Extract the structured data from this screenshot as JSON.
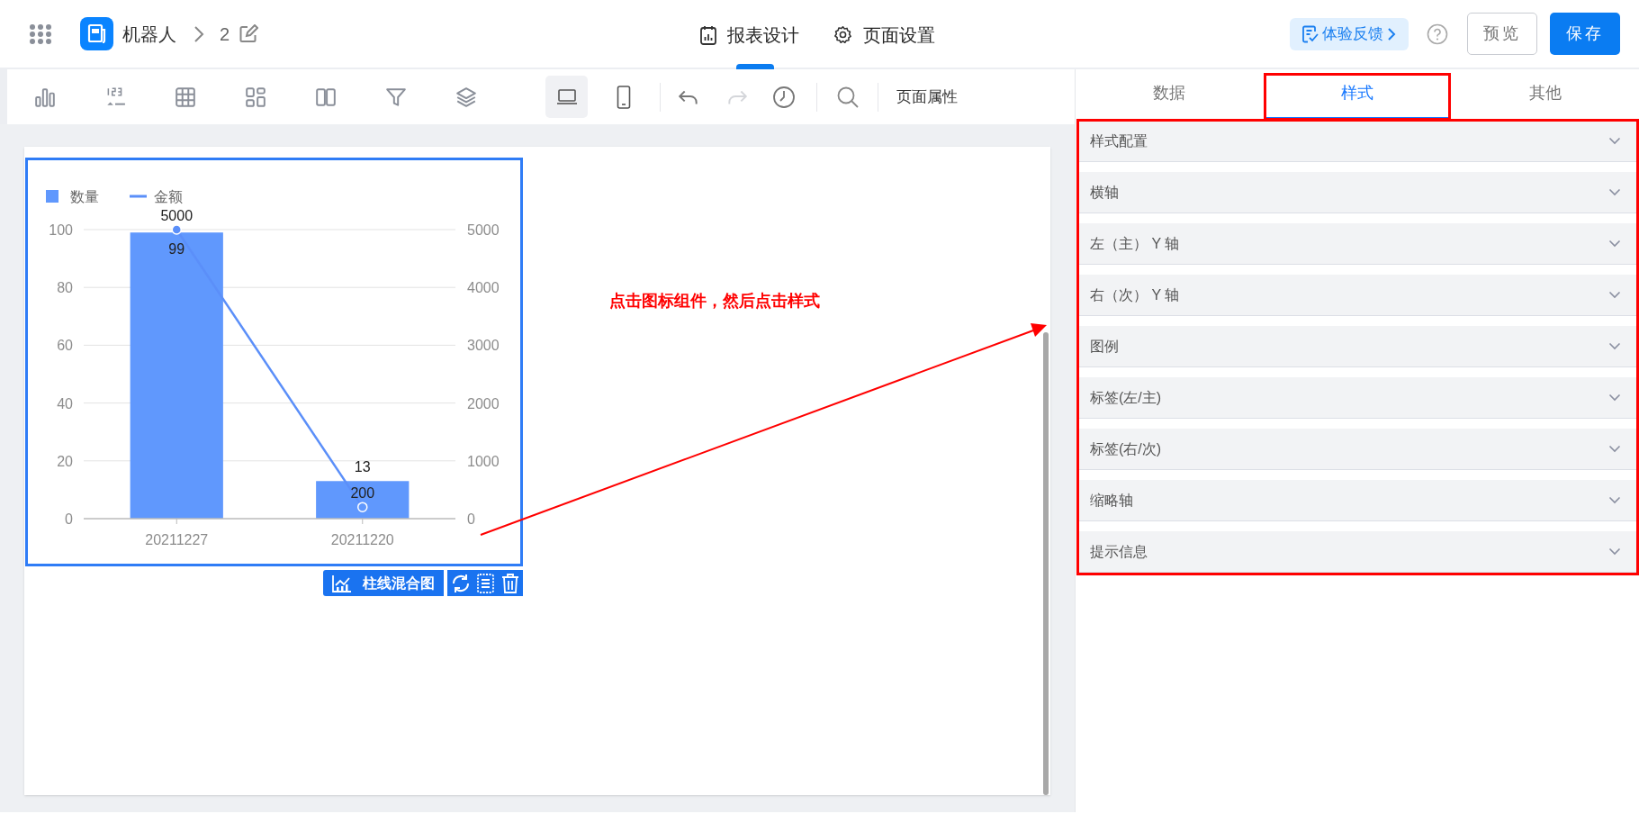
{
  "header": {
    "app_name": "机器人",
    "breadcrumb_page": "2",
    "tabs": [
      {
        "kind": "report",
        "label": "报表设计",
        "selected": true
      },
      {
        "kind": "settings",
        "label": "页面设置",
        "selected": false
      }
    ],
    "feedback": "体验反馈",
    "buttons": [
      {
        "kind": "secondary",
        "label": "预览"
      },
      {
        "kind": "primary",
        "label": "保存"
      }
    ]
  },
  "toolbar": {
    "view_buttons": [
      {
        "kind": "desktop",
        "selected": true
      },
      {
        "kind": "mobile",
        "selected": false
      }
    ],
    "history_buttons": [
      {
        "kind": "undo",
        "disabled": false
      },
      {
        "kind": "redo",
        "disabled": true
      }
    ],
    "page_properties": "页面属性"
  },
  "chart_component": {
    "type_label": "柱线混合图",
    "bar_layer": {
      "chart_data": {
        "type": "bar",
        "categories": [
          "20211227",
          "20211220"
        ],
        "series": [
          {
            "name": "数量",
            "color": "#6098fd",
            "values": [
              99,
              13
            ]
          }
        ],
        "ylim": [
          0,
          100
        ],
        "yticks": [
          0,
          20,
          40,
          60,
          80,
          100
        ],
        "grid": true,
        "data_labels": true
      }
    },
    "line_layer": {
      "chart_data": {
        "type": "line",
        "series": [
          {
            "name": "金额",
            "color": "#5b8ff9",
            "marker": "circle",
            "values": [
              5000,
              200
            ]
          }
        ],
        "ylim": [
          0,
          5000
        ],
        "yticks": [
          0,
          1000,
          2000,
          3000,
          4000,
          5000
        ],
        "data_labels": true
      }
    }
  },
  "annotation": {
    "text": "点击图标组件，然后点击样式"
  },
  "panel": {
    "tabs": [
      {
        "label": "数据",
        "selected": false
      },
      {
        "label": "样式",
        "selected": true
      },
      {
        "label": "其他",
        "selected": false
      }
    ],
    "sections": [
      {
        "label": "样式配置",
        "expanded": false
      },
      {
        "label": "横轴",
        "expanded": false
      },
      {
        "label": "左（主） Y 轴",
        "expanded": false
      },
      {
        "label": "右（次） Y 轴",
        "expanded": false
      },
      {
        "label": "图例",
        "expanded": false
      },
      {
        "label": "标签(左/主)",
        "expanded": false
      },
      {
        "label": "标签(右/次)",
        "expanded": false
      },
      {
        "label": "缩略轴",
        "expanded": false
      },
      {
        "label": "提示信息",
        "expanded": false
      }
    ]
  }
}
